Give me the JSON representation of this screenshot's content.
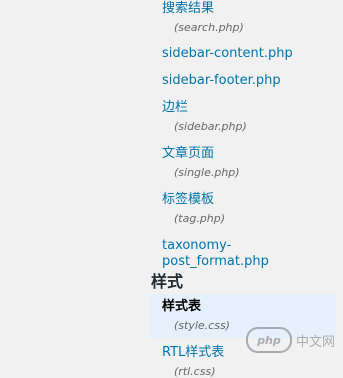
{
  "files_top": [
    {
      "label": "搜索结果",
      "filename": "(search.php)"
    },
    {
      "label": "sidebar-content.php",
      "filename": ""
    },
    {
      "label": "sidebar-footer.php",
      "filename": ""
    },
    {
      "label": "边栏",
      "filename": "(sidebar.php)"
    },
    {
      "label": "文章页面",
      "filename": "(single.php)"
    },
    {
      "label": "标签模板",
      "filename": "(tag.php)"
    },
    {
      "label": "taxonomy-post_format.php",
      "filename": ""
    }
  ],
  "styles_section": {
    "title": "样式"
  },
  "files_styles": [
    {
      "label": "样式表",
      "filename": "(style.css)",
      "selected": true
    },
    {
      "label": "RTL样式表",
      "filename": "(rtl.css)",
      "selected": false
    }
  ],
  "watermark": {
    "logo": "php",
    "text": "中文网"
  }
}
